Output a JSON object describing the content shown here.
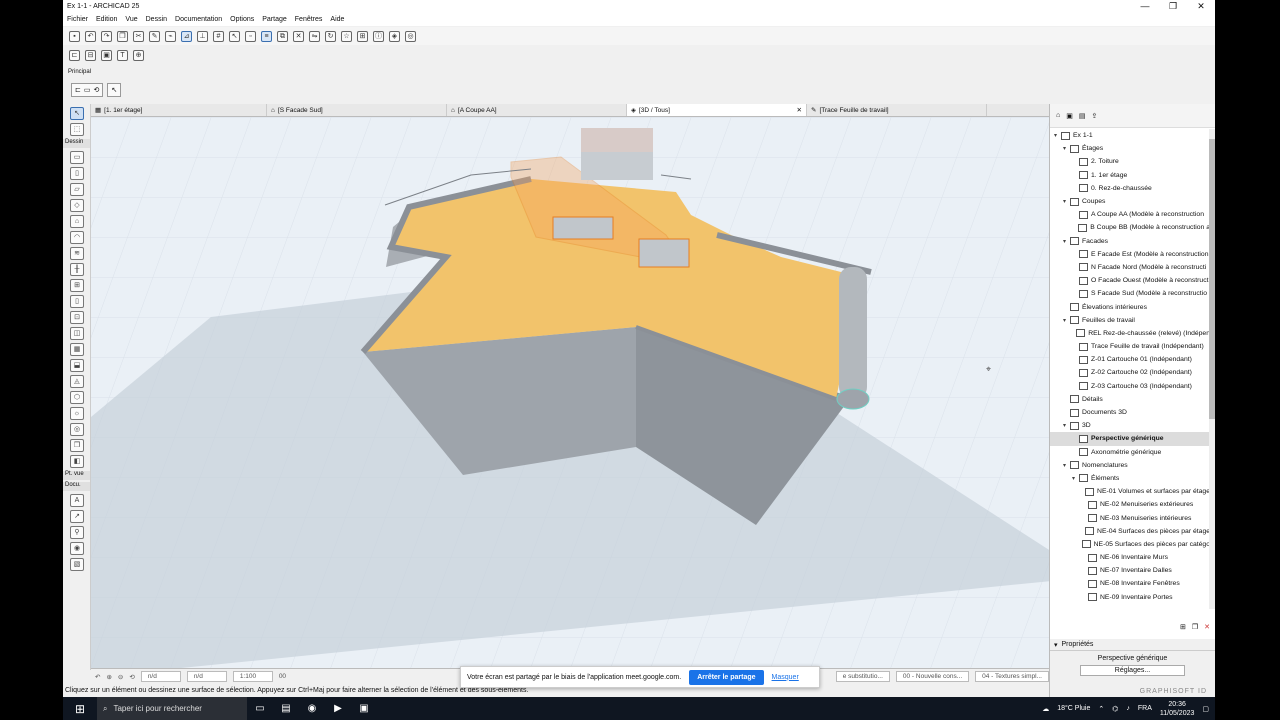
{
  "window": {
    "title": "Ex 1-1 - ARCHICAD 25",
    "controls": [
      "—",
      "❐",
      "✕"
    ]
  },
  "menu": [
    "Fichier",
    "Edition",
    "Vue",
    "Dessin",
    "Documentation",
    "Options",
    "Partage",
    "Fenêtres",
    "Aide"
  ],
  "toolbar_label": "Principal",
  "toolbox": {
    "dessin_label": "Dessin",
    "ptvue_label": "Pt. vue",
    "docu_label": "Docu."
  },
  "tabs": [
    {
      "label": "[1. 1er étage]",
      "icon": "floorplan-icon"
    },
    {
      "label": "[S Facade Sud]",
      "icon": "elevation-icon"
    },
    {
      "label": "[A Coupe AA]",
      "icon": "section-icon"
    },
    {
      "label": "[3D / Tous]",
      "icon": "3d-icon"
    },
    {
      "label": "[Trace Feuille de travail]",
      "icon": "worksheet-icon"
    }
  ],
  "statusbar": {
    "field1": "n/d",
    "field2": "n/d",
    "scale": "1:100",
    "field4": "00",
    "layer1": "e substitutio...",
    "layer2": "00 - Nouvelle cons...",
    "layer3": "04 - Textures simpl..."
  },
  "share": {
    "message": "Votre écran est partagé par le biais de l'application meet.google.com.",
    "stop_button": "Arrêter le partage",
    "hide_link": "Masquer"
  },
  "hint": "Cliquez sur un élément ou dessinez une surface de sélection. Appuyez sur Ctrl+Maj pour faire alterner la sélection de l'élément et des sous-éléments.",
  "navigator": {
    "items": [
      {
        "label": "Ex 1-1",
        "level": 0,
        "caret": "▾"
      },
      {
        "label": "Étages",
        "level": 1,
        "caret": "▾"
      },
      {
        "label": "2. Toiture",
        "level": 2,
        "caret": ""
      },
      {
        "label": "1. 1er étage",
        "level": 2,
        "caret": ""
      },
      {
        "label": "0. Rez-de-chaussée",
        "level": 2,
        "caret": ""
      },
      {
        "label": "Coupes",
        "level": 1,
        "caret": "▾"
      },
      {
        "label": "A Coupe AA (Modèle à reconstruction",
        "level": 2,
        "caret": ""
      },
      {
        "label": "B Coupe BB (Modèle à reconstruction a",
        "level": 2,
        "caret": ""
      },
      {
        "label": "Facades",
        "level": 1,
        "caret": "▾"
      },
      {
        "label": "E Facade Est (Modèle à reconstruction",
        "level": 2,
        "caret": ""
      },
      {
        "label": "N Facade Nord (Modèle à reconstructi",
        "level": 2,
        "caret": ""
      },
      {
        "label": "O Facade Ouest (Modèle à reconstruct",
        "level": 2,
        "caret": ""
      },
      {
        "label": "S Facade Sud (Modèle à reconstructio",
        "level": 2,
        "caret": ""
      },
      {
        "label": "Élevations intérieures",
        "level": 1,
        "caret": ""
      },
      {
        "label": "Feuilles de travail",
        "level": 1,
        "caret": "▾"
      },
      {
        "label": "REL Rez-de-chaussée (relevé) (Indépen",
        "level": 2,
        "caret": ""
      },
      {
        "label": "Trace Feuille de travail (Indépendant)",
        "level": 2,
        "caret": ""
      },
      {
        "label": "Z-01 Cartouche 01 (Indépendant)",
        "level": 2,
        "caret": ""
      },
      {
        "label": "Z-02 Cartouche 02 (Indépendant)",
        "level": 2,
        "caret": ""
      },
      {
        "label": "Z-03 Cartouche 03 (Indépendant)",
        "level": 2,
        "caret": ""
      },
      {
        "label": "Détails",
        "level": 1,
        "caret": ""
      },
      {
        "label": "Documents 3D",
        "level": 1,
        "caret": ""
      },
      {
        "label": "3D",
        "level": 1,
        "caret": "▾"
      },
      {
        "label": "Perspective générique",
        "level": 2,
        "caret": "",
        "selected": true
      },
      {
        "label": "Axonométrie générique",
        "level": 2,
        "caret": ""
      },
      {
        "label": "Nomenclatures",
        "level": 1,
        "caret": "▾"
      },
      {
        "label": "Éléments",
        "level": 2,
        "caret": "▾"
      },
      {
        "label": "NE-01 Volumes et surfaces par étage",
        "level": 3,
        "caret": ""
      },
      {
        "label": "NE-02 Menuiseries extérieures",
        "level": 3,
        "caret": ""
      },
      {
        "label": "NE-03 Menuiseries intérieures",
        "level": 3,
        "caret": ""
      },
      {
        "label": "NE-04 Surfaces des pièces par étage",
        "level": 3,
        "caret": ""
      },
      {
        "label": "NE-05 Surfaces des pièces par catégo",
        "level": 3,
        "caret": ""
      },
      {
        "label": "NE-06 Inventaire Murs",
        "level": 3,
        "caret": ""
      },
      {
        "label": "NE-07 Inventaire Dalles",
        "level": 3,
        "caret": ""
      },
      {
        "label": "NE-08 Inventaire Fenêtres",
        "level": 3,
        "caret": ""
      },
      {
        "label": "NE-09 Inventaire Portes",
        "level": 3,
        "caret": ""
      }
    ]
  },
  "properties": {
    "title": "Propriétés",
    "value": "Perspective générique",
    "settings_button": "Réglages...",
    "brand": "GRAPHISOFT ID"
  },
  "taskbar": {
    "search_placeholder": "Taper ici pour rechercher",
    "weather": "18°C Pluie",
    "lang": "FRA",
    "time": "20:36",
    "date": "11/05/2023"
  },
  "colors": {
    "slab": "#f2c36b",
    "wall": "#a6acb3",
    "ground": "#c9d3dc",
    "accent": "#1a73e8"
  }
}
